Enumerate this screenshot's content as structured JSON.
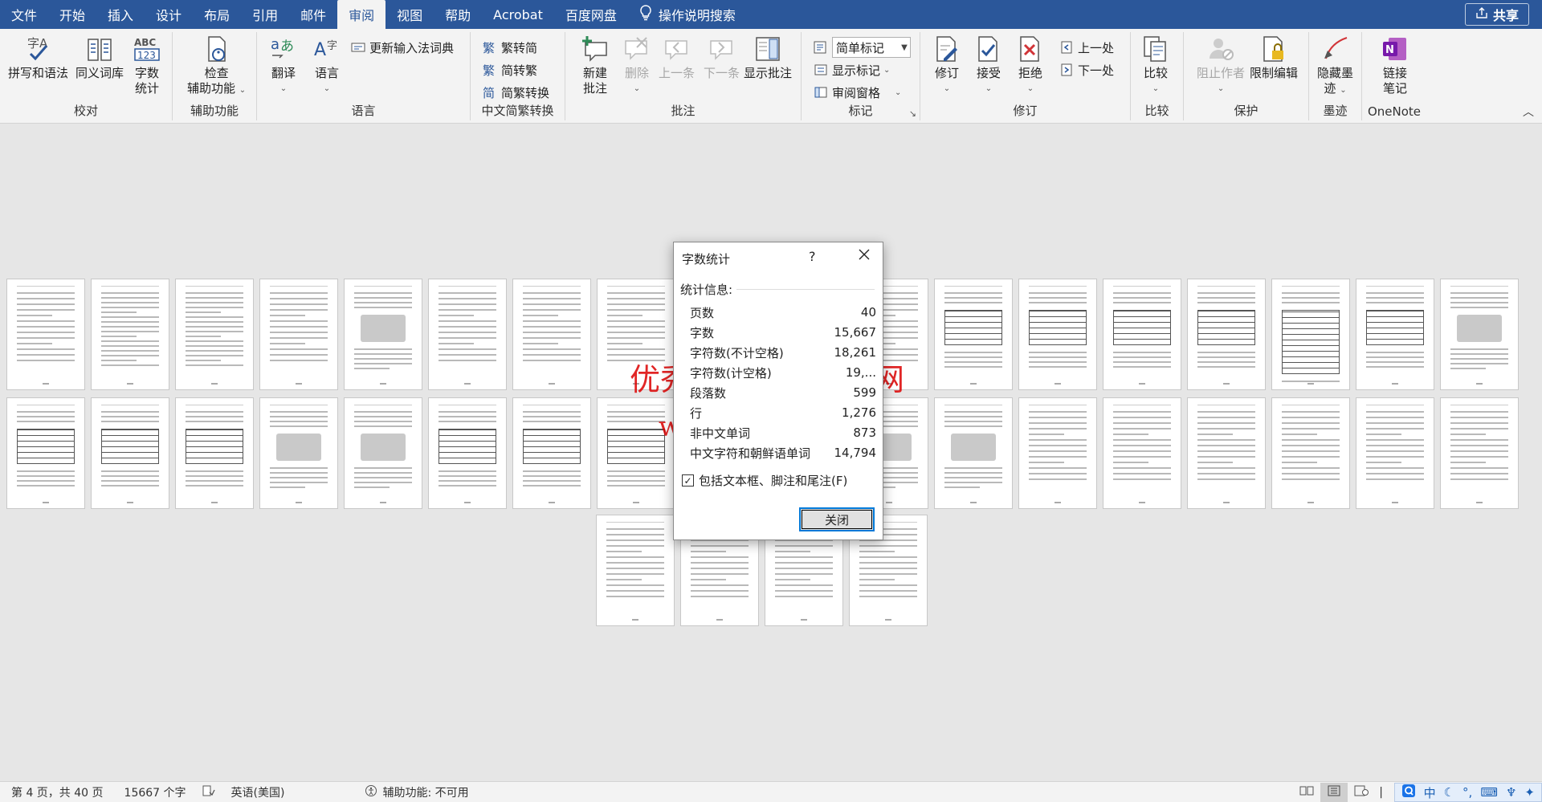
{
  "menu": {
    "tabs": [
      "文件",
      "开始",
      "插入",
      "设计",
      "布局",
      "引用",
      "邮件",
      "审阅",
      "视图",
      "帮助",
      "Acrobat",
      "百度网盘"
    ],
    "active_tab": "审阅",
    "search_label": "操作说明搜索",
    "share_label": "共享"
  },
  "ribbon": {
    "proofing": {
      "label": "校对",
      "spelling": "拼写和语法",
      "thesaurus": "同义词库",
      "wordcount_line1": "字数",
      "wordcount_line2": "统计"
    },
    "accessibility": {
      "label": "辅助功能",
      "check_line1": "检查",
      "check_line2": "辅助功能"
    },
    "language": {
      "label": "语言",
      "translate": "翻译",
      "language": "语言",
      "update_ime": "更新输入法词典"
    },
    "chinese_conversion": {
      "label": "中文简繁转换",
      "to_traditional": "繁转简",
      "to_simplified": "简转繁",
      "convert": "简繁转换"
    },
    "comments": {
      "label": "批注",
      "new_line1": "新建",
      "new_line2": "批注",
      "delete": "删除",
      "previous": "上一条",
      "next": "下一条",
      "show": "显示批注"
    },
    "tracking": {
      "label": "标记",
      "markup_combo": "简单标记",
      "show_markup": "显示标记",
      "reviewing_pane": "审阅窗格"
    },
    "revisions": {
      "label": "修订",
      "track": "修订",
      "accept": "接受",
      "reject": "拒绝",
      "previous": "上一处",
      "next": "下一处"
    },
    "compare": {
      "label": "比较",
      "compare": "比较"
    },
    "protect": {
      "label": "保护",
      "block_authors": "阻止作者",
      "restrict": "限制编辑"
    },
    "ink": {
      "label": "墨迹",
      "hide_line1": "隐藏墨",
      "hide_line2": "迹"
    },
    "onenote": {
      "label": "OneNote",
      "link_line1": "链接",
      "link_line2": "笔记"
    }
  },
  "watermark": {
    "line1": "优秀毕业设计资源网",
    "line2": "www.keyicad.cn"
  },
  "dialog": {
    "title": "字数统计",
    "help": "?",
    "section": "统计信息:",
    "stats": [
      {
        "label": "页数",
        "value": "40"
      },
      {
        "label": "字数",
        "value": "15,667"
      },
      {
        "label": "字符数(不计空格)",
        "value": "18,261"
      },
      {
        "label": "字符数(计空格)",
        "value": "19,..."
      },
      {
        "label": "段落数",
        "value": "599"
      },
      {
        "label": "行",
        "value": "1,276"
      },
      {
        "label": "非中文单词",
        "value": "873"
      },
      {
        "label": "中文字符和朝鲜语单词",
        "value": "14,794"
      }
    ],
    "include_label": "包括文本框、脚注和尾注(F)",
    "include_checked": true,
    "close_label": "关闭"
  },
  "statusbar": {
    "page": "第 4 页，共 40 页",
    "words": "15667 个字",
    "language": "英语(美国)",
    "accessibility": "辅助功能: 不可用",
    "ime_label": "中"
  },
  "colors": {
    "accent": "#2b579a",
    "watermark": "#dc0000",
    "focus": "#0078d7"
  }
}
